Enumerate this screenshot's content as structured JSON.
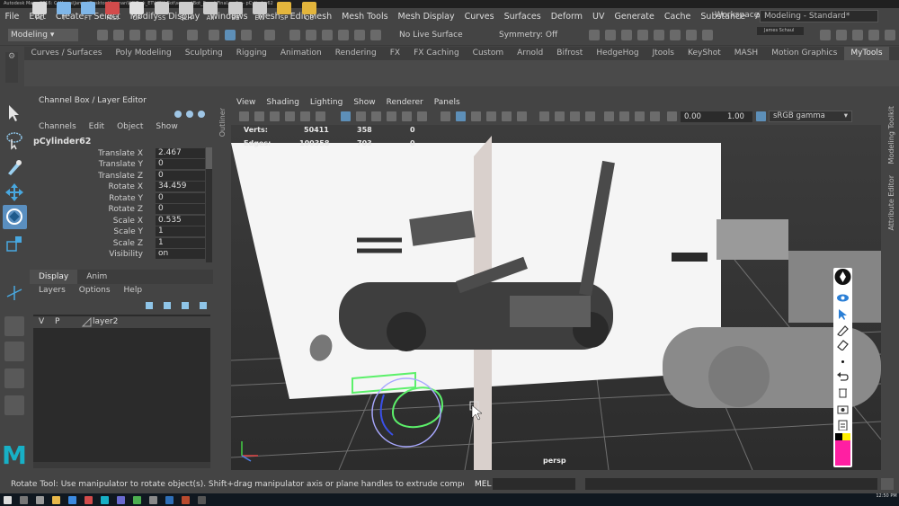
{
  "window_title": "Autodesk Maya 2016: C:\\Users\\James\\Desktop\\Jjosman\\HII\\Turk_ET\\UGV_Bot\\scenes\\Bot_RoughFinal.ma* --- pCylinder62",
  "menubar": [
    "File",
    "Edit",
    "Create",
    "Select",
    "Modify",
    "Display",
    "Windows",
    "Mesh",
    "Edit Mesh",
    "Mesh Tools",
    "Mesh Display",
    "Curves",
    "Surfaces",
    "Deform",
    "UV",
    "Generate",
    "Cache",
    "Substance",
    "Arnold"
  ],
  "workspace": {
    "label": "Workspace :",
    "value": "Modeling - Standard*"
  },
  "status_line": {
    "mode": "Modeling",
    "live_surface": "No Live Surface",
    "symmetry": "Symmetry: Off",
    "user": "James Schaul"
  },
  "shelf_tabs": [
    "Curves / Surfaces",
    "Poly Modeling",
    "Sculpting",
    "Rigging",
    "Animation",
    "Rendering",
    "FX",
    "FX Caching",
    "Custom",
    "Arnold",
    "Bifrost",
    "HedgeHog",
    "Jtools",
    "KeyShot",
    "MASH",
    "Motion Graphics",
    "MyTools"
  ],
  "shelf_buttons": [
    {
      "label": "PC",
      "color": "#d9d9d9"
    },
    {
      "label": "T",
      "color": "#7fb6e8"
    },
    {
      "label": "FT",
      "color": "#7fb6e8"
    },
    {
      "label": "Hist",
      "color": "#d24b4b"
    },
    {
      "label": "CP",
      "color": "#e0e0e0"
    },
    {
      "label": "SS",
      "color": "#cccccc"
    },
    {
      "label": "SLH",
      "color": "#cccccc"
    },
    {
      "label": "All",
      "color": "#cccccc"
    },
    {
      "label": "BE",
      "color": "#cccccc"
    },
    {
      "label": "EW",
      "color": "#cccccc"
    },
    {
      "label": "SP",
      "color": "#e3b53c"
    },
    {
      "label": "OS",
      "color": "#e3b53c"
    }
  ],
  "channel_box": {
    "title": "Channel Box / Layer Editor",
    "menus": [
      "Channels",
      "Edit",
      "Object",
      "Show"
    ],
    "object_name": "pCylinder62",
    "attributes": [
      {
        "name": "Translate X",
        "value": "2.467"
      },
      {
        "name": "Translate Y",
        "value": "0"
      },
      {
        "name": "Translate Z",
        "value": "0"
      },
      {
        "name": "Rotate X",
        "value": "34.459"
      },
      {
        "name": "Rotate Y",
        "value": "0"
      },
      {
        "name": "Rotate Z",
        "value": "0"
      },
      {
        "name": "Scale X",
        "value": "0.535"
      },
      {
        "name": "Scale Y",
        "value": "1"
      },
      {
        "name": "Scale Z",
        "value": "1"
      },
      {
        "name": "Visibility",
        "value": "on"
      }
    ]
  },
  "layer_editor": {
    "tabs": [
      "Display",
      "Anim"
    ],
    "menus": [
      "Layers",
      "Options",
      "Help"
    ],
    "layer": {
      "v": "V",
      "p": "P",
      "name": "layer2"
    }
  },
  "side_tabs": {
    "outliner": "Outliner",
    "modeling_toolkit": "Modeling Toolkit",
    "attribute_editor": "Attribute Editor"
  },
  "viewport": {
    "menus": [
      "View",
      "Shading",
      "Lighting",
      "Show",
      "Renderer",
      "Panels"
    ],
    "exposure": "0.00",
    "gamma": "1.00",
    "color_space": "sRGB gamma",
    "hud": [
      {
        "label": "Verts:",
        "total": "50411",
        "selected": "358",
        "comp": "0"
      },
      {
        "label": "Edges:",
        "total": "100358",
        "selected": "703",
        "comp": "0"
      }
    ],
    "camera": "persp"
  },
  "help_line": "Rotate Tool: Use manipulator to rotate object(s). Shift+drag manipulator axis or plane handles to extrude components or clone objects. Ctrl+Sh",
  "command_line": {
    "language": "MEL"
  },
  "taskbar": {
    "time": "12:50 PM"
  }
}
